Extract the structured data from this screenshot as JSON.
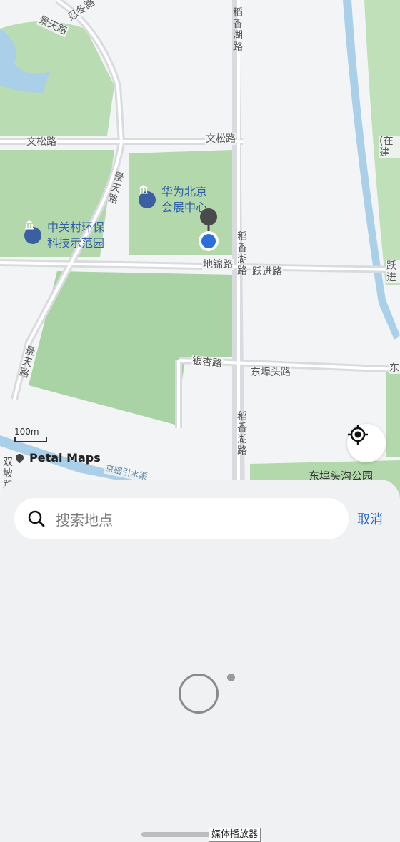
{
  "map": {
    "roads": {
      "renzhi": "忍冬路",
      "jingtian_top": "景天路",
      "wensong_left": "文松路",
      "wensong_right": "文松路",
      "daoxiang_top": "稻香湖路",
      "daoxiang_mid": "稻香湖路",
      "daoxiang_bottom": "稻香湖路",
      "jingtian_mid": "景天路",
      "jingtian_bottom": "景天路",
      "dijin": "地锦路",
      "yuejin": "跃进路",
      "yuejin_right": "跃进",
      "yinxing": "银杏路",
      "dongbutou": "东埠头路",
      "dongbutou_right": "东",
      "zaijian": "(在建",
      "shuangpo": "双坡路",
      "jingmi": "京密引水渠"
    },
    "pois": {
      "expo_center": "华为北京会展中心",
      "expo_line1": "华为北京",
      "expo_line2": "会展中心",
      "zgc_park": "中关村环保科技示范园",
      "zgc_line1": "中关村环保",
      "zgc_line2": "科技示范园",
      "dongbutou_park": "东埠头沟公园"
    },
    "scale_label": "100m",
    "brand": "Petal Maps",
    "locate_icon": "crosshair-locate-icon"
  },
  "search": {
    "placeholder": "搜索地点",
    "cancel_label": "取消"
  },
  "tooltip": "媒体播放器",
  "colors": {
    "accent": "#2468c7",
    "green_area": "#a9d3a4",
    "water": "#a9d0e8",
    "location_dot": "#2a6fdb"
  }
}
